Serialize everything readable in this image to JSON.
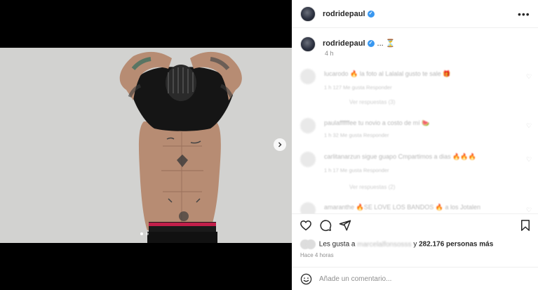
{
  "post": {
    "author": "rodridepaul",
    "caption_suffix": "... ⏳",
    "time_short": "4 h",
    "more_label": "•••"
  },
  "comments": [
    {
      "text": "lucarodo 🔥 la foto al Lalalal gusto te sale 🎁",
      "meta": "1 h   127 Me gusta   Responder",
      "replies": "Ver respuestas (3)"
    },
    {
      "text": "paulaffffffee tu novio a costo de mí 🍉",
      "meta": "1 h   32 Me gusta   Responder",
      "replies": ""
    },
    {
      "text": "carlitanarzun sigue guapo Cmpartimos a dias 🔥🔥🔥",
      "meta": "1 h   17 Me gusta   Responder",
      "replies": "Ver respuestas (2)"
    },
    {
      "text": "amaranthe 🔥SE LOVE LOS BANDOS 🔥 a los Jotalen",
      "meta": "",
      "replies": ""
    }
  ],
  "likes": {
    "prefix": "Les gusta a",
    "user": "marcelalfonsosss",
    "connector": "y",
    "count_text": "282.176 personas más"
  },
  "time_ago": "Hace 4 horas",
  "comment_box": {
    "placeholder": "Añade un comentario..."
  },
  "icons": {
    "like": "heart-icon",
    "comment": "comment-icon",
    "share": "share-icon",
    "save": "bookmark-icon",
    "emoji": "emoji-icon",
    "next": "chevron-right-icon",
    "verified": "verified-badge-icon"
  },
  "colors": {
    "verified": "#3897f0",
    "text": "#262626",
    "muted": "#8e8e8e"
  },
  "carousel": {
    "current_index": 1,
    "total": 2
  }
}
